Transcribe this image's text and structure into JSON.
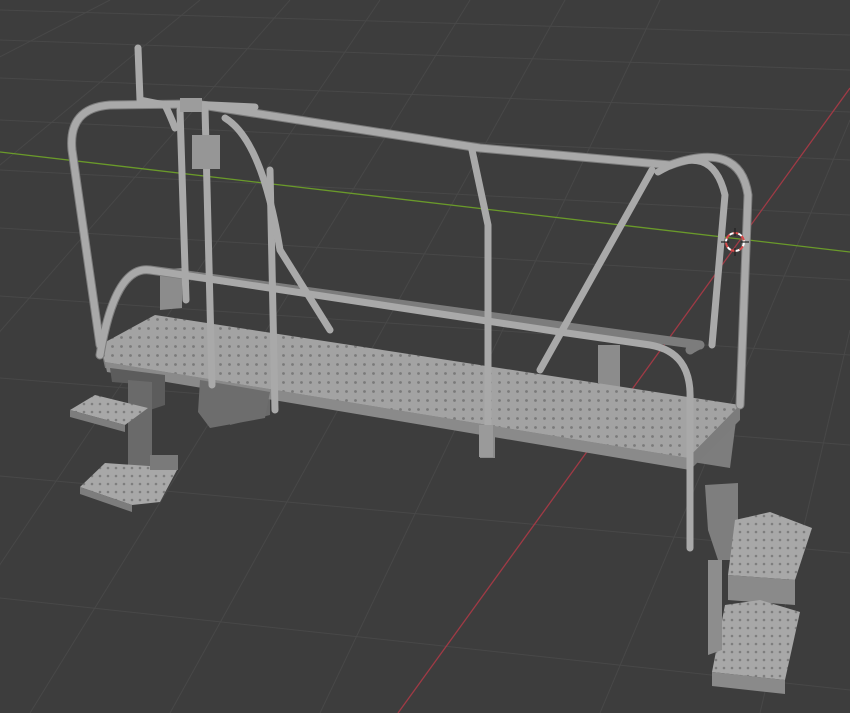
{
  "app": "3D viewport",
  "colors": {
    "background": "#3d3d3d",
    "grid": "#474747",
    "x_axis": "#a03a45",
    "y_axis": "#6a9a2a",
    "model_light": "#a6a6a6",
    "model_mid": "#8f8f8f",
    "model_dark": "#5b5b5b",
    "cursor_red": "#d94a4a"
  },
  "scene": {
    "object": "platform-with-railings-and-steps",
    "shading": "solid",
    "cursor_icon": "3d-cursor-icon"
  }
}
